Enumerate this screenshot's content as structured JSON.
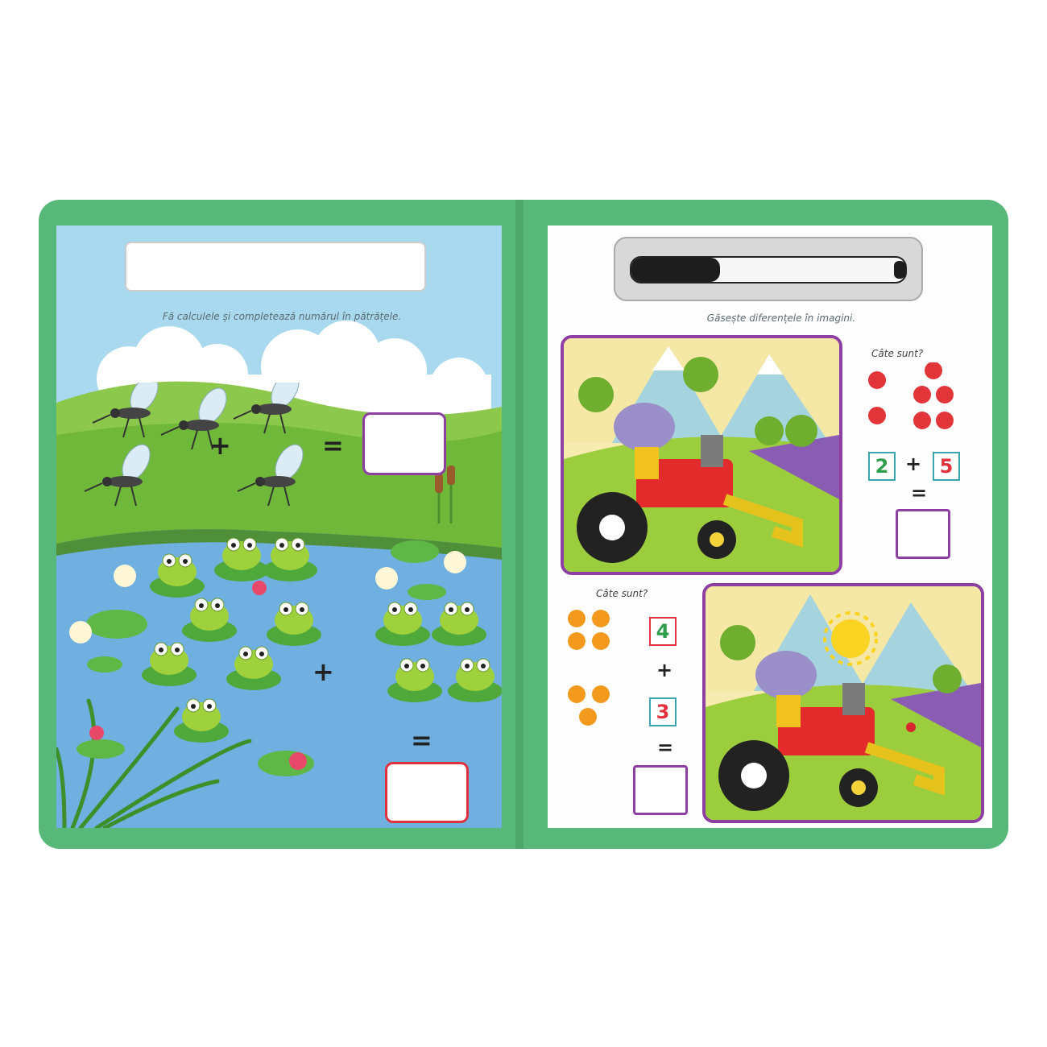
{
  "left_page": {
    "instruction": "Fă calculele și completează numărul în pătrățele.",
    "row1": {
      "plus": "+",
      "equals": "="
    },
    "row2": {
      "plus": "+",
      "equals": "="
    }
  },
  "right_page": {
    "instruction": "Găsește diferențele în imagini.",
    "apples": {
      "question": "Câte sunt?",
      "a": "2",
      "plus": "+",
      "b": "5",
      "equals": "="
    },
    "oranges": {
      "question": "Câte sunt?",
      "a": "4",
      "plus": "+",
      "b": "3",
      "equals": "="
    }
  },
  "colors": {
    "folder": "#58b879",
    "frame": "#8e3fa3",
    "answer_red": "#e2313c",
    "number_green": "#2e9e4c",
    "number_red": "#e2313c"
  },
  "icons": [
    "mosquito-icon",
    "frog-icon",
    "water-lily-icon",
    "apple-icon",
    "orange-icon",
    "tractor-icon",
    "hippo-icon",
    "sun-icon",
    "marker-pen-icon"
  ]
}
